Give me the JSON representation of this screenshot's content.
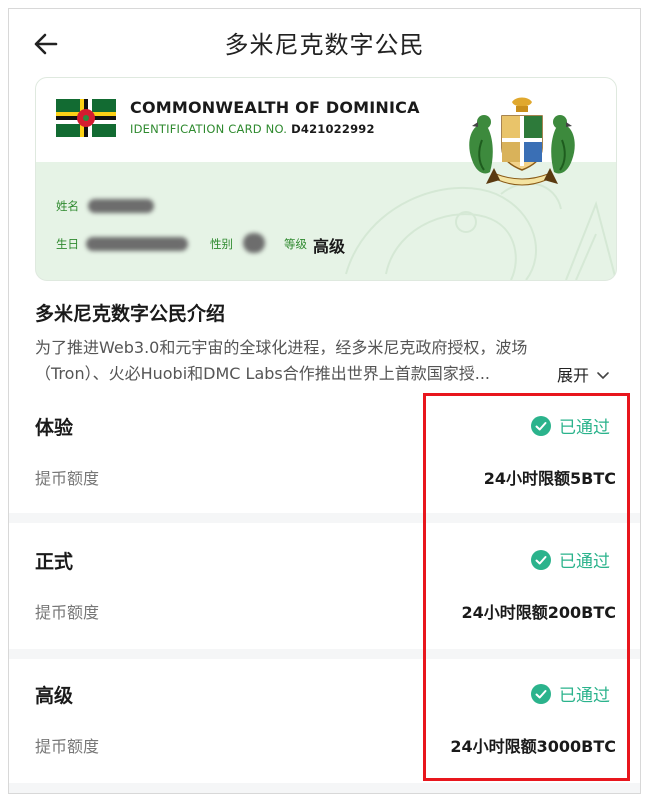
{
  "header": {
    "title": "多米尼克数字公民"
  },
  "card": {
    "country": "COMMONWEALTH OF DOMINICA",
    "id_label": "IDENTIFICATION CARD NO.",
    "id_number": "D421022992",
    "name_label": "姓名",
    "birth_label": "生日",
    "gender_label": "性别",
    "level_label": "等级",
    "level_value": "高级"
  },
  "intro": {
    "title": "多米尼克数字公民介绍",
    "line1": "为了推进Web3.0和元宇宙的全球化进程，经多米尼克政府授权，波场",
    "line2": "（Tron）、火必Huobi和DMC Labs合作推出世界上首款国家授...",
    "expand_label": "展开"
  },
  "sections": [
    {
      "name": "体验",
      "status": "已通过",
      "limit_label": "提币额度",
      "limit_value": "24小时限额5BTC"
    },
    {
      "name": "正式",
      "status": "已通过",
      "limit_label": "提币额度",
      "limit_value": "24小时限额200BTC"
    },
    {
      "name": "高级",
      "status": "已通过",
      "limit_label": "提币额度",
      "limit_value": "24小时限额3000BTC"
    }
  ],
  "colors": {
    "accent_green": "#2bb38c",
    "card_green": "#2f8a2f",
    "highlight_red": "#e8161d",
    "card_bg": "#e6f3e6"
  },
  "icons": {
    "back": "arrow-left-icon",
    "status": "check-circle-icon",
    "expand": "chevron-down-icon"
  }
}
